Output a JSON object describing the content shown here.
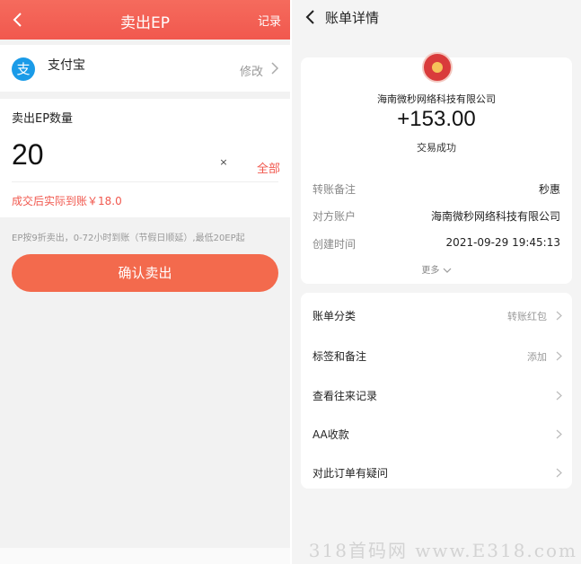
{
  "left": {
    "header": {
      "title": "卖出EP",
      "record": "记录"
    },
    "payment": {
      "name": "支付宝",
      "icon_char": "支",
      "modify": "修改"
    },
    "amount": {
      "label": "卖出EP数量",
      "value": "20",
      "clear": "×",
      "all": "全部",
      "actual": "成交后实际到账￥18.0"
    },
    "note": "EP按9折卖出，0-72小时到账（节假日顺延）,最低20EP起",
    "confirm": "确认卖出"
  },
  "right": {
    "header": {
      "title": "账单详情"
    },
    "company": "海南微秒网络科技有限公司",
    "amount": "+153.00",
    "status": "交易成功",
    "details": [
      {
        "key": "转账备注",
        "value": "秒惠"
      },
      {
        "key": "对方账户",
        "value": "海南微秒网络科技有限公司"
      },
      {
        "key": "创建时间",
        "value": "2021-09-29 19:45:13"
      }
    ],
    "more": "更多",
    "menu": [
      {
        "label": "账单分类",
        "value": "转账红包"
      },
      {
        "label": "标签和备注",
        "value": "添加"
      },
      {
        "label": "查看往来记录",
        "value": ""
      },
      {
        "label": "AA收款",
        "value": ""
      },
      {
        "label": "对此订单有疑问",
        "value": ""
      }
    ]
  },
  "watermark": "318首码网 www.E318.com",
  "colors": {
    "accent": "#f1584e",
    "button": "#f36a4d",
    "alipay": "#1a9be8"
  }
}
